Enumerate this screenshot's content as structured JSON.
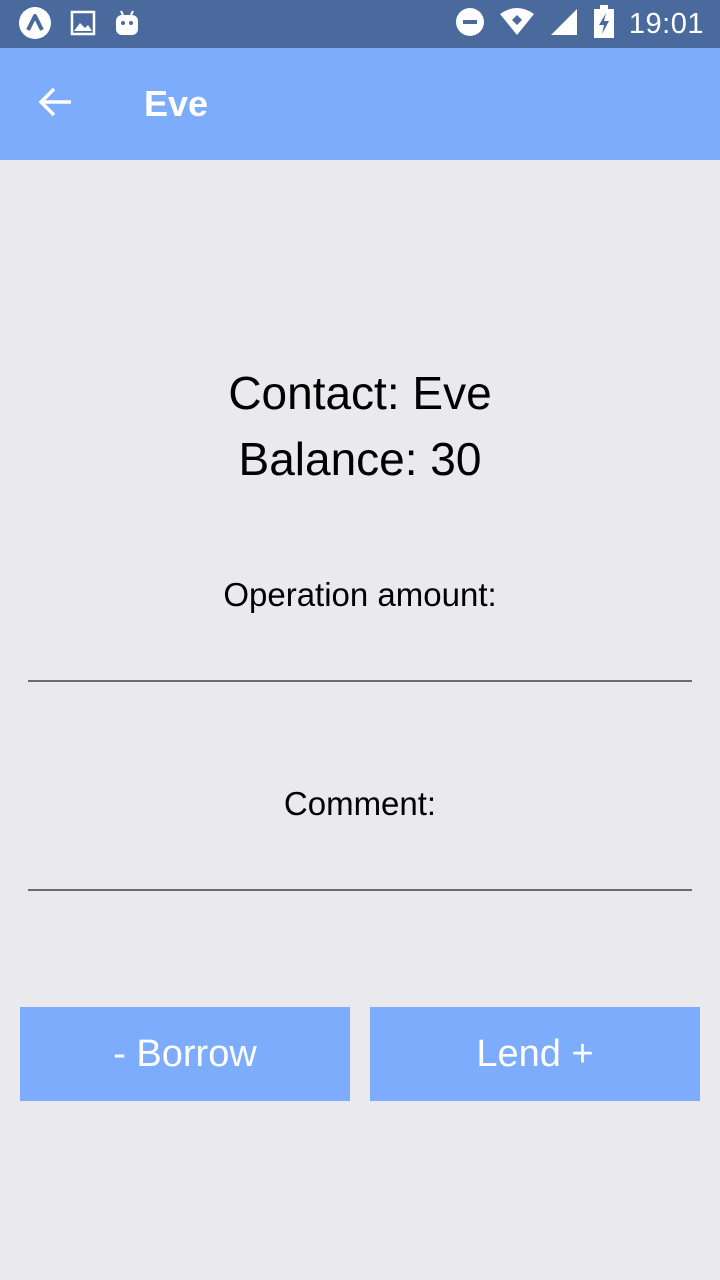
{
  "status_bar": {
    "time": "19:01",
    "icons": [
      "app-launcher-icon",
      "image-icon",
      "android-icon",
      "do-not-disturb-icon",
      "wifi-icon",
      "signal-icon",
      "battery-charging-icon"
    ]
  },
  "app_bar": {
    "title": "Eve",
    "back_icon": "arrow-back-icon"
  },
  "contact": {
    "contact_line": "Contact: Eve",
    "balance_line": "Balance: 30"
  },
  "form": {
    "amount_label": "Operation amount:",
    "amount_value": "",
    "comment_label": "Comment:",
    "comment_value": ""
  },
  "actions": {
    "borrow_label": "- Borrow",
    "lend_label": "Lend +"
  },
  "colors": {
    "status_bar": "#4a6a9d",
    "accent": "#7dacfc",
    "background": "#e9e9ee"
  }
}
